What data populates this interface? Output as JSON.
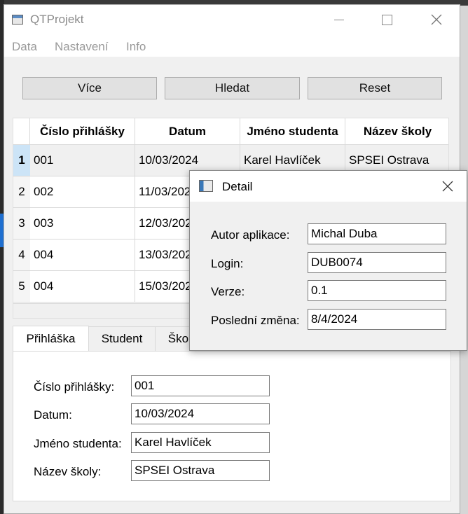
{
  "window": {
    "title": "QTProjekt"
  },
  "menu": {
    "items": [
      "Data",
      "Nastavení",
      "Info"
    ]
  },
  "toolbar": {
    "more_label": "Více",
    "search_label": "Hledat",
    "reset_label": "Reset"
  },
  "table": {
    "headers": [
      "Číslo přihlášky",
      "Datum",
      "Jméno studenta",
      "Název školy"
    ],
    "rows": [
      {
        "num": "1",
        "cislo": "001",
        "datum": "10/03/2024",
        "jmeno": "Karel Havlíček",
        "skola": "SPSEI Ostrava"
      },
      {
        "num": "2",
        "cislo": "002",
        "datum": "11/03/2024",
        "jmeno": "",
        "skola": ""
      },
      {
        "num": "3",
        "cislo": "003",
        "datum": "12/03/2024",
        "jmeno": "",
        "skola": ""
      },
      {
        "num": "4",
        "cislo": "004",
        "datum": "13/03/2024",
        "jmeno": "",
        "skola": ""
      },
      {
        "num": "5",
        "cislo": "004",
        "datum": "15/03/2024",
        "jmeno": "",
        "skola": ""
      }
    ]
  },
  "tabs": {
    "items": [
      "Přihláška",
      "Student",
      "Škola"
    ],
    "active": "Přihláška"
  },
  "form": {
    "cislo_label": "Číslo přihlášky:",
    "cislo_value": "001",
    "datum_label": "Datum:",
    "datum_value": "10/03/2024",
    "jmeno_label": "Jméno studenta:",
    "jmeno_value": "Karel Havlíček",
    "skola_label": "Název školy:",
    "skola_value": "SPSEI Ostrava"
  },
  "dialog": {
    "title": "Detail",
    "autor_label": "Autor aplikace:",
    "autor_value": "Michal Duba",
    "login_label": "Login:",
    "login_value": "DUB0074",
    "verze_label": "Verze:",
    "verze_value": "0.1",
    "zmena_label": "Poslední změna:",
    "zmena_value": "8/4/2024"
  }
}
